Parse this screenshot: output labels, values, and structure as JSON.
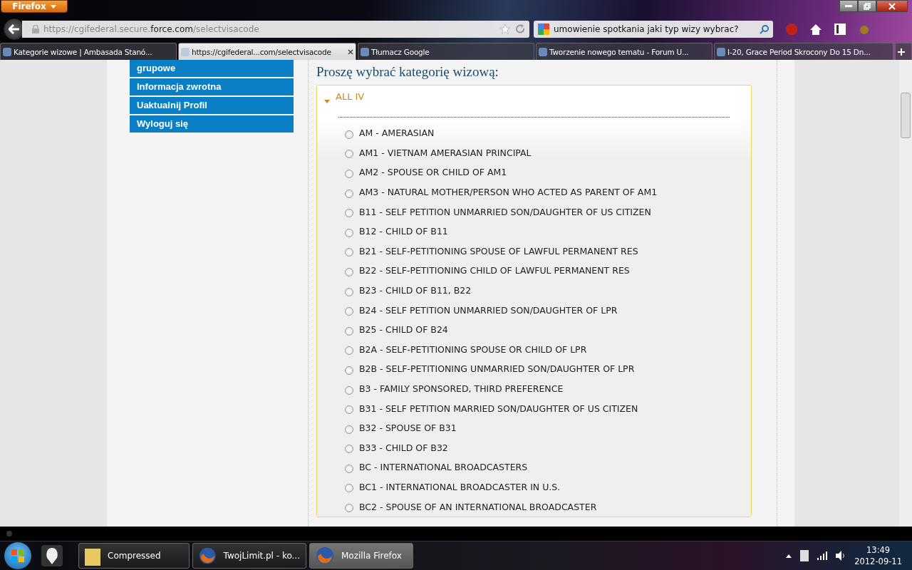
{
  "browser": {
    "menu_button": "Firefox",
    "url_prefix": "https://cgifederal.secure.",
    "url_domain": "force.com",
    "url_path": "/selectvisacode",
    "search_value": "umowienie spotkania jaki typ wizy wybrac?"
  },
  "tabs": [
    {
      "label": "Kategorie wizowe | Ambasada Stanó...",
      "selected": false
    },
    {
      "label": "https://cgifederal...com/selectvisacode",
      "selected": true
    },
    {
      "label": "Tłumacz Google",
      "selected": false
    },
    {
      "label": "Tworzenie nowego tematu - Forum U...",
      "selected": false
    },
    {
      "label": "I-20, Grace Period Skrocony Do 15 Dn...",
      "selected": false
    }
  ],
  "sidebar": {
    "items": [
      "grupowe",
      "Informacja zwrotna",
      "Uaktualnij Profil",
      "Wyloguj się"
    ]
  },
  "heading": "Proszę wybrać kategorię wizową:",
  "accordion": {
    "title": "ALL IV",
    "expanded": true,
    "options": [
      {
        "label": "AM - AMERASIAN",
        "selected": false
      },
      {
        "label": "AM1 - VIETNAM AMERASIAN PRINCIPAL",
        "selected": false
      },
      {
        "label": "AM2 - SPOUSE OR CHILD OF AM1",
        "selected": false
      },
      {
        "label": "AM3 - NATURAL MOTHER/PERSON WHO ACTED AS PARENT OF AM1",
        "selected": false
      },
      {
        "label": "B11 - SELF PETITION UNMARRIED SON/DAUGHTER OF US CITIZEN",
        "selected": false
      },
      {
        "label": "B12 - CHILD OF B11",
        "selected": false
      },
      {
        "label": "B21 - SELF-PETITIONING SPOUSE OF LAWFUL PERMANENT RES",
        "selected": false
      },
      {
        "label": "B22 - SELF-PETITIONING CHILD OF LAWFUL PERMANENT RES",
        "selected": false
      },
      {
        "label": "B23 - CHILD OF B11, B22",
        "selected": false
      },
      {
        "label": "B24 - SELF PETITION UNMARRIED SON/DAUGHTER OF LPR",
        "selected": false
      },
      {
        "label": "B25 - CHILD OF B24",
        "selected": false
      },
      {
        "label": "B2A - SELF-PETITIONING SPOUSE OR CHILD OF LPR",
        "selected": false
      },
      {
        "label": "B2B - SELF-PETITIONING UNMARRIED SON/DAUGHTER OF LPR",
        "selected": false
      },
      {
        "label": "B3 - FAMILY SPONSORED, THIRD PREFERENCE",
        "selected": false
      },
      {
        "label": "B31 - SELF PETITION MARRIED SON/DAUGHTER OF US CITIZEN",
        "selected": false
      },
      {
        "label": "B32 - SPOUSE OF B31",
        "selected": false
      },
      {
        "label": "B33 - CHILD OF B32",
        "selected": false
      },
      {
        "label": "BC - INTERNATIONAL BROADCASTERS",
        "selected": false
      },
      {
        "label": "BC1 - INTERNATIONAL BROADCASTER IN U.S.",
        "selected": false
      },
      {
        "label": "BC2 - SPOUSE OF AN INTERNATIONAL BROADCASTER",
        "selected": false
      }
    ]
  },
  "taskbar": {
    "items": [
      {
        "label": "Compressed",
        "kind": "folder",
        "selected": false
      },
      {
        "label": "TwojLimit.pl - ko...",
        "kind": "browser",
        "selected": false
      },
      {
        "label": "Mozilla Firefox",
        "kind": "browser",
        "selected": true
      }
    ],
    "time": "13:49",
    "date": "2012-09-11"
  }
}
